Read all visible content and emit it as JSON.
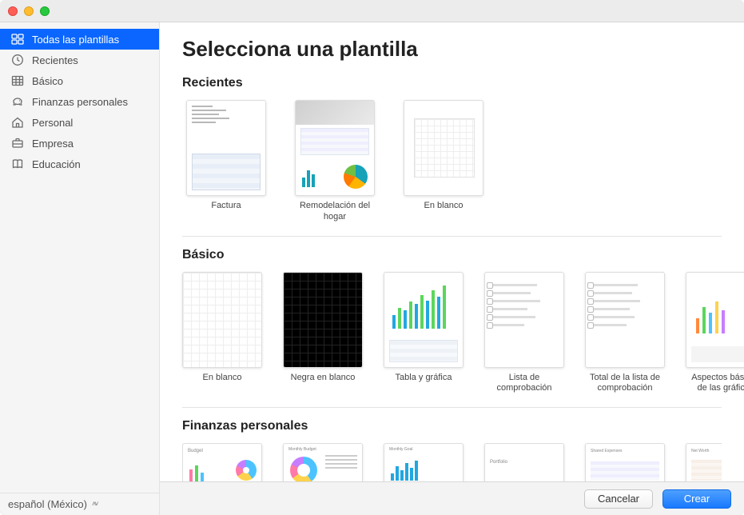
{
  "header": {
    "title": "Selecciona una plantilla"
  },
  "sidebar": {
    "items": [
      {
        "label": "Todas las plantillas",
        "icon": "grid-icon",
        "selected": true
      },
      {
        "label": "Recientes",
        "icon": "clock-icon"
      },
      {
        "label": "Básico",
        "icon": "table-icon"
      },
      {
        "label": "Finanzas personales",
        "icon": "piggy-icon"
      },
      {
        "label": "Personal",
        "icon": "house-icon"
      },
      {
        "label": "Empresa",
        "icon": "briefcase-icon"
      },
      {
        "label": "Educación",
        "icon": "book-icon"
      }
    ],
    "language": "español (México)"
  },
  "sections": [
    {
      "title": "Recientes",
      "templates": [
        {
          "label": "Factura",
          "thumb": "invoice"
        },
        {
          "label": "Remodelación del hogar",
          "thumb": "remodel"
        },
        {
          "label": "En blanco",
          "thumb": "blank-half"
        }
      ]
    },
    {
      "title": "Básico",
      "templates": [
        {
          "label": "En blanco",
          "thumb": "blank-grid"
        },
        {
          "label": "Negra en blanco",
          "thumb": "dark"
        },
        {
          "label": "Tabla y gráfica",
          "thumb": "table-chart"
        },
        {
          "label": "Lista de comprobación",
          "thumb": "checklist"
        },
        {
          "label": "Total de la lista de comprobación",
          "thumb": "checklist"
        },
        {
          "label": "Aspectos básicos de las gráficas",
          "thumb": "chart-basics"
        }
      ]
    },
    {
      "title": "Finanzas personales",
      "templates": [
        {
          "label": "",
          "thumb": "budget"
        },
        {
          "label": "",
          "thumb": "monthly-budget"
        },
        {
          "label": "",
          "thumb": "monthly-goal"
        },
        {
          "label": "",
          "thumb": "portfolio"
        },
        {
          "label": "",
          "thumb": "shared"
        },
        {
          "label": "",
          "thumb": "networth"
        }
      ]
    }
  ],
  "footer": {
    "cancel": "Cancelar",
    "create": "Crear"
  }
}
